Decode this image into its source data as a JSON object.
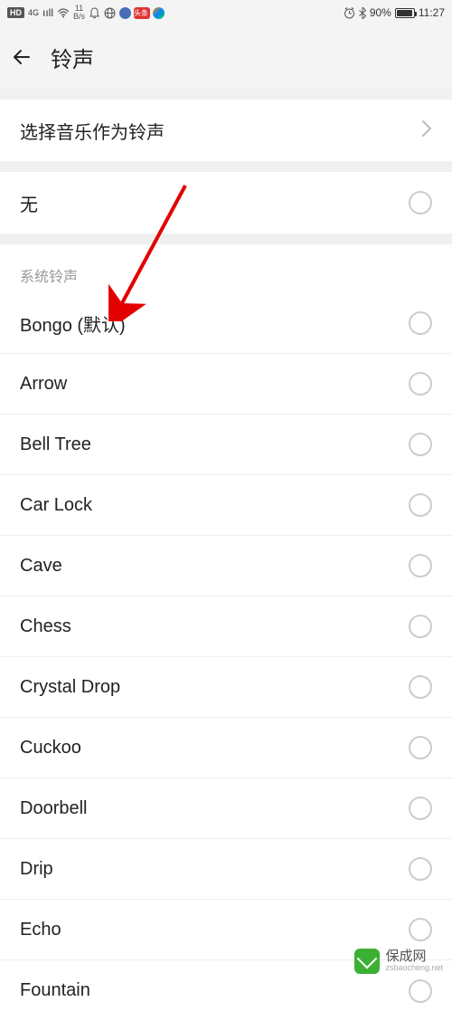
{
  "status_bar": {
    "hd": "HD",
    "net": "4G",
    "signal": "ııll",
    "wifi": "⋮",
    "speed_val": "11",
    "speed_unit": "B/s",
    "alarm": "⏰",
    "bt": "✱",
    "battery_pct": "90%",
    "time": "11:27"
  },
  "header": {
    "title": "铃声"
  },
  "music_row": {
    "label": "选择音乐作为铃声"
  },
  "none_row": {
    "label": "无"
  },
  "section_title": "系统铃声",
  "ringtones": [
    {
      "label": "Bongo (默认)"
    },
    {
      "label": "Arrow"
    },
    {
      "label": "Bell Tree"
    },
    {
      "label": "Car Lock"
    },
    {
      "label": "Cave"
    },
    {
      "label": "Chess"
    },
    {
      "label": "Crystal Drop"
    },
    {
      "label": "Cuckoo"
    },
    {
      "label": "Doorbell"
    },
    {
      "label": "Drip"
    },
    {
      "label": "Echo"
    },
    {
      "label": "Fountain"
    }
  ],
  "watermark": {
    "main": "保成网",
    "sub": "zsbaocheng.net"
  }
}
